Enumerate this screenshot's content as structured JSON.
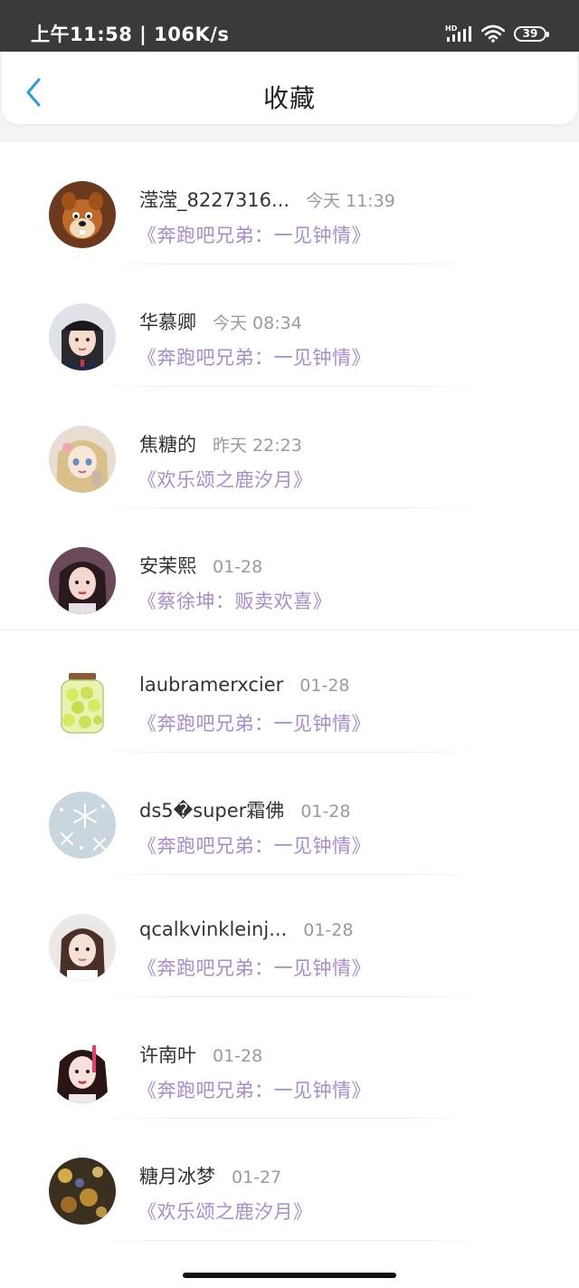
{
  "status_bar": {
    "time": "上午11:58 | 106K/s",
    "signal_label": "HD",
    "battery": "39"
  },
  "header": {
    "title": "收藏"
  },
  "items": [
    {
      "name": "滢滢_8227316...",
      "time": "今天 11:39",
      "title": "《奔跑吧兄弟：一见钟情》",
      "avatar": "chipmunk-avatar"
    },
    {
      "name": "华慕卿",
      "time": "今天 08:34",
      "title": "《奔跑吧兄弟：一见钟情》",
      "avatar": "anime-girl-cap-avatar"
    },
    {
      "name": "焦糖的",
      "time": "昨天 22:23",
      "title": "《欢乐颂之鹿汐月》",
      "avatar": "doll-girl-avatar"
    },
    {
      "name": "安茉熙",
      "time": "01-28",
      "title": "《蔡徐坤：贩卖欢喜》",
      "avatar": "girl-portrait-avatar"
    },
    {
      "name": "laubramerxcier",
      "time": "01-28",
      "title": "《奔跑吧兄弟：一见钟情》",
      "avatar": "lemon-jar-avatar"
    },
    {
      "name": "ds5�super霜佛",
      "time": "01-28",
      "title": "《奔跑吧兄弟：一见钟情》",
      "avatar": "snowflake-avatar"
    },
    {
      "name": "qcalkvinkleinj...",
      "time": "01-28",
      "title": "《奔跑吧兄弟：一见钟情》",
      "avatar": "girl-white-avatar"
    },
    {
      "name": "许南叶",
      "time": "01-28",
      "title": "《奔跑吧兄弟：一见钟情》",
      "avatar": "girl-red-hair-avatar"
    },
    {
      "name": "糖月冰梦",
      "time": "01-27",
      "title": "《欢乐颂之鹿汐月》",
      "avatar": "night-lights-avatar"
    }
  ],
  "colors": {
    "accent_purple": "#a98bd0",
    "back_arrow_blue": "#2d9cdb"
  }
}
